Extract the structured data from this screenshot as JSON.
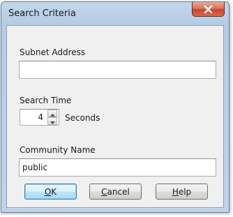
{
  "window": {
    "title": "Search Criteria"
  },
  "subnet": {
    "label": "Subnet Address",
    "value": ""
  },
  "search_time": {
    "label": "Search Time",
    "value": "4",
    "unit": "Seconds"
  },
  "community": {
    "label": "Community Name",
    "value": "public"
  },
  "buttons": {
    "ok": {
      "mnemonic": "O",
      "rest": "K"
    },
    "cancel": {
      "mnemonic": "C",
      "rest": "ancel"
    },
    "help": {
      "mnemonic": "H",
      "rest": "elp"
    }
  },
  "icons": {
    "close": "close-icon",
    "spin_up": "spin-up-arrow-icon",
    "spin_down": "spin-down-arrow-icon"
  },
  "colors": {
    "close_button": "#c4472e",
    "default_button_border": "#3c7fb1",
    "title_bar": "#b5cce6"
  }
}
